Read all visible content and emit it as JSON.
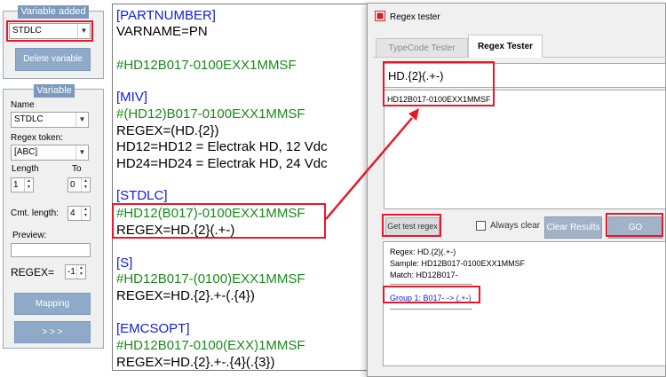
{
  "left": {
    "variable_added": {
      "title": "Variable added",
      "selected": "STDLC",
      "delete_button": "Delete variable"
    },
    "variable": {
      "title": "Variable",
      "name_label": "Name",
      "name_value": "STDLC",
      "regex_token_label": "Regex token:",
      "regex_token_value": "[ABC]",
      "length_label": "Length",
      "to_label": "To",
      "length_value": "1",
      "to_value": "0",
      "cmt_length_label": "Cmt. length:",
      "cmt_length_value": "4",
      "preview_label": "Preview:",
      "preview_value": "",
      "regex_label": "REGEX=",
      "regex_value": "-1",
      "mapping_button": "Mapping",
      "next_button": "> > >"
    }
  },
  "code": {
    "lines": [
      {
        "text": "[PARTNUMBER]",
        "color": "blue"
      },
      {
        "text": "VARNAME=PN",
        "color": "black"
      },
      {
        "text": "#HD12B017-0100EXX1MMSF",
        "color": "green"
      },
      {
        "text": "[MIV]",
        "color": "blue"
      },
      {
        "text": "#(HD12)B017-0100EXX1MMSF",
        "color": "green"
      },
      {
        "text": "REGEX=(HD.{2})",
        "color": "black"
      },
      {
        "text": "HD12=HD12 = Electrak HD, 12 Vdc",
        "color": "black"
      },
      {
        "text": "HD24=HD24 = Electrak HD, 24 Vdc",
        "color": "black"
      },
      {
        "text": "[STDLC]",
        "color": "blue"
      },
      {
        "text": "#HD12(B017)-0100EXX1MMSF",
        "color": "green"
      },
      {
        "text": "REGEX=HD.{2}(.+-)",
        "color": "black"
      },
      {
        "text": "[S]",
        "color": "blue"
      },
      {
        "text": "#HD12B017-(0100)EXX1MMSF",
        "color": "green"
      },
      {
        "text": "REGEX=HD.{2}.+-(.{4})",
        "color": "black"
      },
      {
        "text": "[EMCSOPT]",
        "color": "blue"
      },
      {
        "text": "#HD12B017-0100(EXX)1MMSF",
        "color": "green"
      },
      {
        "text": "REGEX=HD.{2}.+-.{4}(.{3})",
        "color": "black"
      }
    ]
  },
  "regex_window": {
    "title": "Regex tester",
    "tabs": [
      "TypeCode Tester",
      "Regex Tester"
    ],
    "regex_input": "HD.{2}(.+-)",
    "sample_text": "HD12B017-0100EXX1MMSF",
    "get_test_regex": "Get test regex",
    "always_clear": "Always clear",
    "clear_results": "Clear Results",
    "go": "GO",
    "results": {
      "regex_line": "Regex:  HD.{2}(.+-)",
      "sample_line": "Sample:  HD12B017-0100EXX1MMSF",
      "match_line": "Match: HD12B017-",
      "separator": "-------------------------------",
      "group_line": "Group 1:  B017- -> (.+-)"
    }
  },
  "colors": {
    "accent_red": "#e8182a",
    "code_blue": "#1020e0",
    "code_green": "#1a8a1a",
    "panel_title_blue": "#7c99bd"
  }
}
